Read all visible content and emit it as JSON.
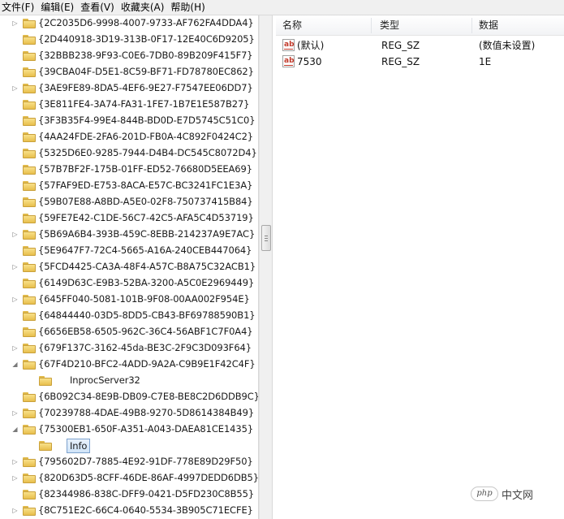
{
  "menu": [
    "文件(F)",
    "编辑(E)",
    "查看(V)",
    "收藏夹(A)",
    "帮助(H)"
  ],
  "tree": {
    "items": [
      {
        "label": "{2C2035D6-9998-4007-9733-AF762FA4DDA4}",
        "expander": "collapsed",
        "depth": 0
      },
      {
        "label": "{2D440918-3D19-313B-0F17-12E40C6D9205}",
        "expander": "none",
        "depth": 0
      },
      {
        "label": "{32BBB238-9F93-C0E6-7DB0-89B209F415F7}",
        "expander": "none",
        "depth": 0
      },
      {
        "label": "{39CBA04F-D5E1-8C59-BF71-FD78780EC862}",
        "expander": "none",
        "depth": 0
      },
      {
        "label": "{3AE9FE89-8DA5-4EF6-9E27-F7547EE06DD7}",
        "expander": "collapsed",
        "depth": 0
      },
      {
        "label": "{3E811FE4-3A74-FA31-1FE7-1B7E1E587B27}",
        "expander": "none",
        "depth": 0
      },
      {
        "label": "{3F3B35F4-99E4-844B-BD0D-E7D5745C51C0}",
        "expander": "none",
        "depth": 0
      },
      {
        "label": "{4AA24FDE-2FA6-201D-FB0A-4C892F0424C2}",
        "expander": "none",
        "depth": 0
      },
      {
        "label": "{5325D6E0-9285-7944-D4B4-DC545C8072D4}",
        "expander": "none",
        "depth": 0
      },
      {
        "label": "{57B7BF2F-175B-01FF-ED52-76680D5EEA69}",
        "expander": "none",
        "depth": 0
      },
      {
        "label": "{57FAF9ED-E753-8ACA-E57C-BC3241FC1E3A}",
        "expander": "none",
        "depth": 0
      },
      {
        "label": "{59B07E88-A8BD-A5E0-02F8-750737415B84}",
        "expander": "none",
        "depth": 0
      },
      {
        "label": "{59FE7E42-C1DE-56C7-42C5-AFA5C4D53719}",
        "expander": "none",
        "depth": 0
      },
      {
        "label": "{5B69A6B4-393B-459C-8EBB-214237A9E7AC}",
        "expander": "collapsed",
        "depth": 0
      },
      {
        "label": "{5E9647F7-72C4-5665-A16A-240CEB447064}",
        "expander": "none",
        "depth": 0
      },
      {
        "label": "{5FCD4425-CA3A-48F4-A57C-B8A75C32ACB1}",
        "expander": "collapsed",
        "depth": 0
      },
      {
        "label": "{6149D63C-E9B3-52BA-3200-A5C0E2969449}",
        "expander": "none",
        "depth": 0
      },
      {
        "label": "{645FF040-5081-101B-9F08-00AA002F954E}",
        "expander": "collapsed",
        "depth": 0
      },
      {
        "label": "{64844440-03D5-8DD5-CB43-BF69788590B1}",
        "expander": "none",
        "depth": 0
      },
      {
        "label": "{6656EB58-6505-962C-36C4-56ABF1C7F0A4}",
        "expander": "none",
        "depth": 0
      },
      {
        "label": "{679F137C-3162-45da-BE3C-2F9C3D093F64}",
        "expander": "collapsed",
        "depth": 0
      },
      {
        "label": "{67F4D210-BFC2-4ADD-9A2A-C9B9E1F42C4F}",
        "expander": "expanded",
        "depth": 0
      },
      {
        "label": "InprocServer32",
        "expander": "none",
        "depth": 1
      },
      {
        "label": "{6B092C34-8E9B-DB09-C7E8-BE8C2D6DDB9C}",
        "expander": "none",
        "depth": 0
      },
      {
        "label": "{70239788-4DAE-49B8-9270-5D8614384B49}",
        "expander": "collapsed",
        "depth": 0
      },
      {
        "label": "{75300EB1-650F-A351-A043-DAEA81CE1435}",
        "expander": "expanded",
        "depth": 0
      },
      {
        "label": "Info",
        "expander": "none",
        "depth": 1,
        "selected": true
      },
      {
        "label": "{795602D7-7885-4E92-91DF-778E89D29F50}",
        "expander": "collapsed",
        "depth": 0
      },
      {
        "label": "{820D63D5-8CFF-46DE-86AF-4997DEDD6DB5}",
        "expander": "collapsed",
        "depth": 0
      },
      {
        "label": "{82344986-838C-DFF9-0421-D5FD230C8B55}",
        "expander": "none",
        "depth": 0
      },
      {
        "label": "{8C751E2C-66C4-0640-5534-3B905C71ECFE}",
        "expander": "collapsed",
        "depth": 0
      }
    ]
  },
  "list": {
    "columns": [
      "名称",
      "类型",
      "数据"
    ],
    "rows": [
      {
        "name": "(默认)",
        "type": "REG_SZ",
        "data": "(数值未设置)"
      },
      {
        "name": "7530",
        "type": "REG_SZ",
        "data": "1E"
      }
    ],
    "icon_label": "ab"
  },
  "watermark": {
    "logo": "php",
    "text": "中文网"
  }
}
